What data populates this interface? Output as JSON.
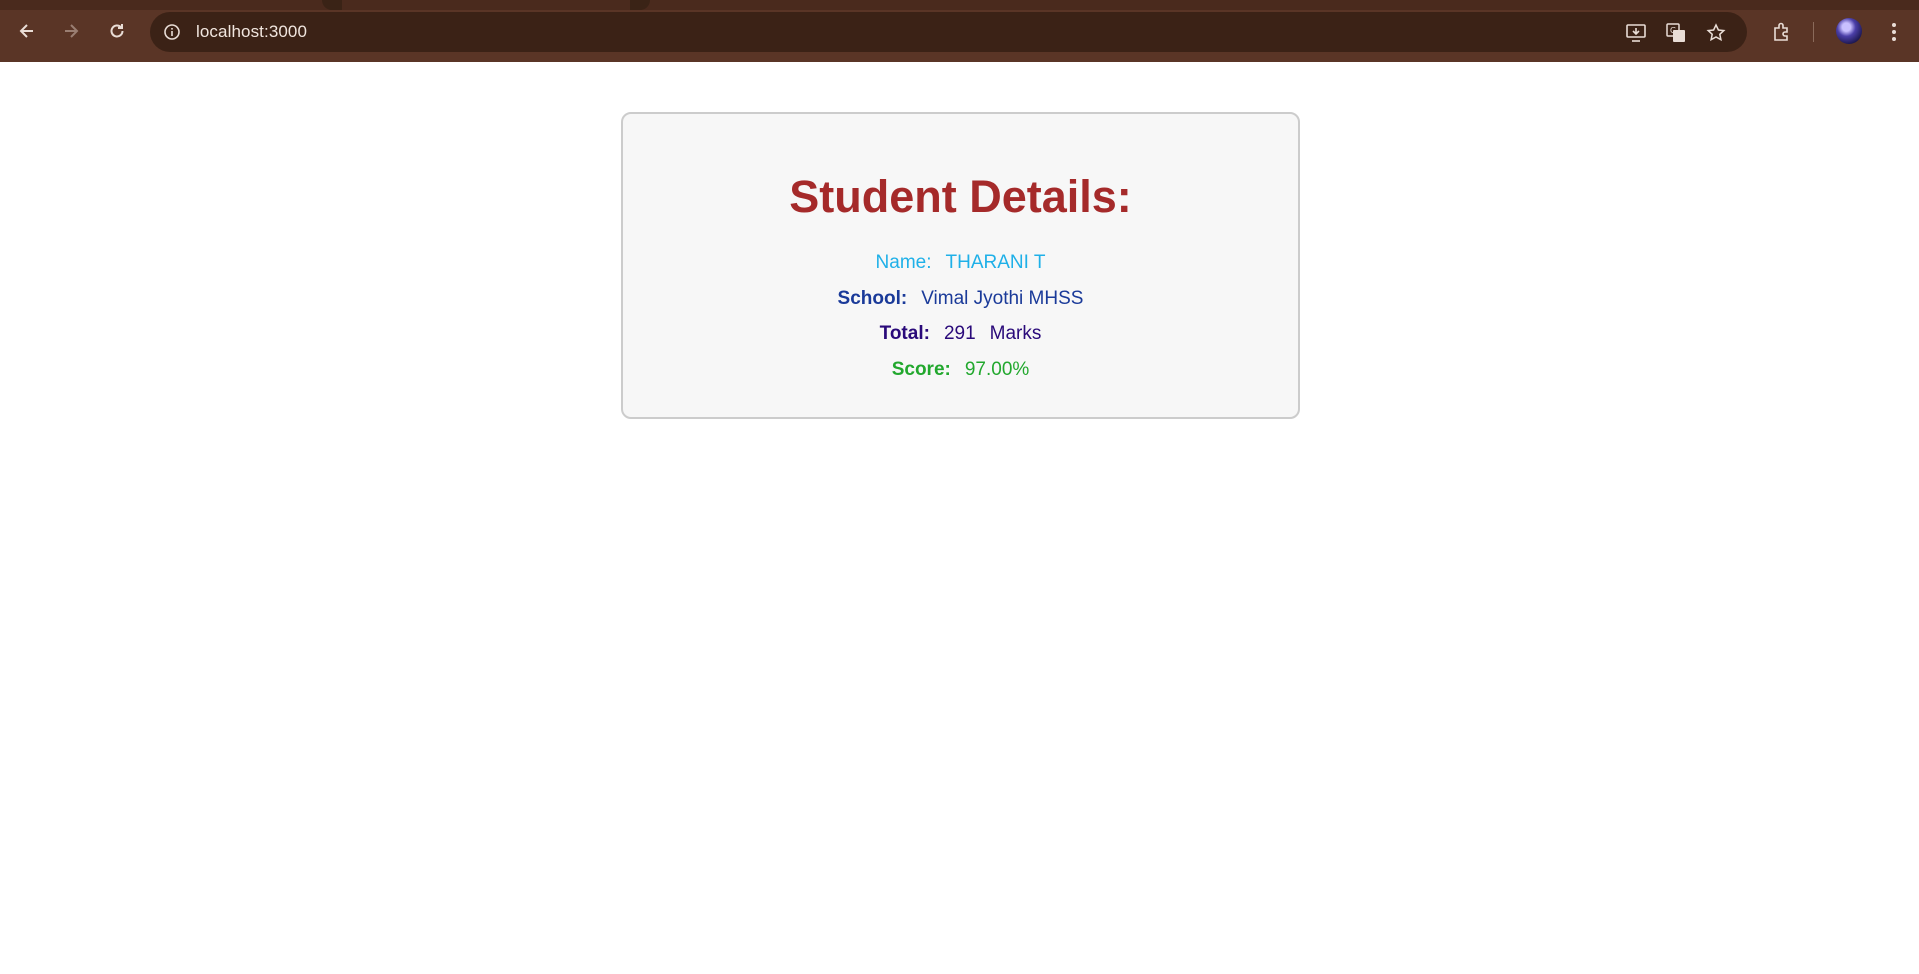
{
  "browser": {
    "url": "localhost:3000",
    "colors": {
      "toolbar": "#5a3526",
      "omnibox": "#3b2216"
    },
    "icons": [
      "back-icon",
      "forward-icon",
      "reload-icon",
      "site-info-icon",
      "install-app-icon",
      "translate-icon",
      "bookmark-star-icon",
      "extensions-icon",
      "profile-avatar",
      "menu-icon"
    ]
  },
  "card": {
    "title": "Student Details:",
    "name_label": "Name:",
    "name_value": "THARANI T",
    "school_label": "School:",
    "school_value": "Vimal Jyothi MHSS",
    "total_label": "Total:",
    "total_value": "291",
    "total_unit": "Marks",
    "score_label": "Score:",
    "score_value": "97.00%",
    "colors": {
      "title": "#a52a2a",
      "name": "#1fb0e8",
      "school": "#1a3a99",
      "total": "#2a0a7a",
      "score": "#22a82e"
    }
  }
}
